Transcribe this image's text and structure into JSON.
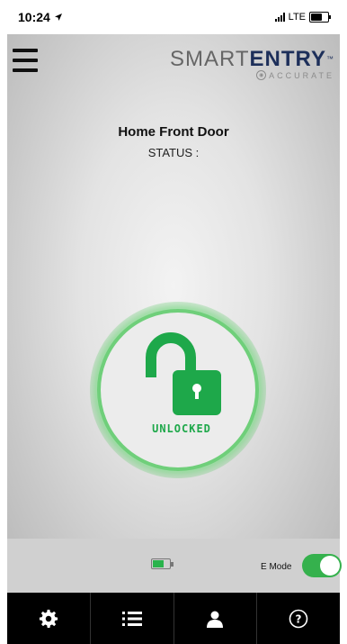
{
  "status_bar": {
    "time": "10:24",
    "network": "LTE"
  },
  "brand": {
    "name_light": "SMART",
    "name_bold": "ENTRY",
    "tm": "™",
    "sub": "ACCURATE"
  },
  "door": {
    "title": "Home Front Door",
    "status_label": "STATUS :"
  },
  "lock": {
    "state_label": "UNLOCKED"
  },
  "controls": {
    "emode_label": "E Mode",
    "emode_on": true,
    "battery_level": "high"
  },
  "colors": {
    "accent_green": "#1ea84a",
    "toggle_green": "#35b14d",
    "tabbar_bg": "#000000"
  },
  "tabs": [
    {
      "icon": "gear-icon"
    },
    {
      "icon": "list-icon"
    },
    {
      "icon": "user-icon"
    },
    {
      "icon": "help-icon"
    }
  ]
}
